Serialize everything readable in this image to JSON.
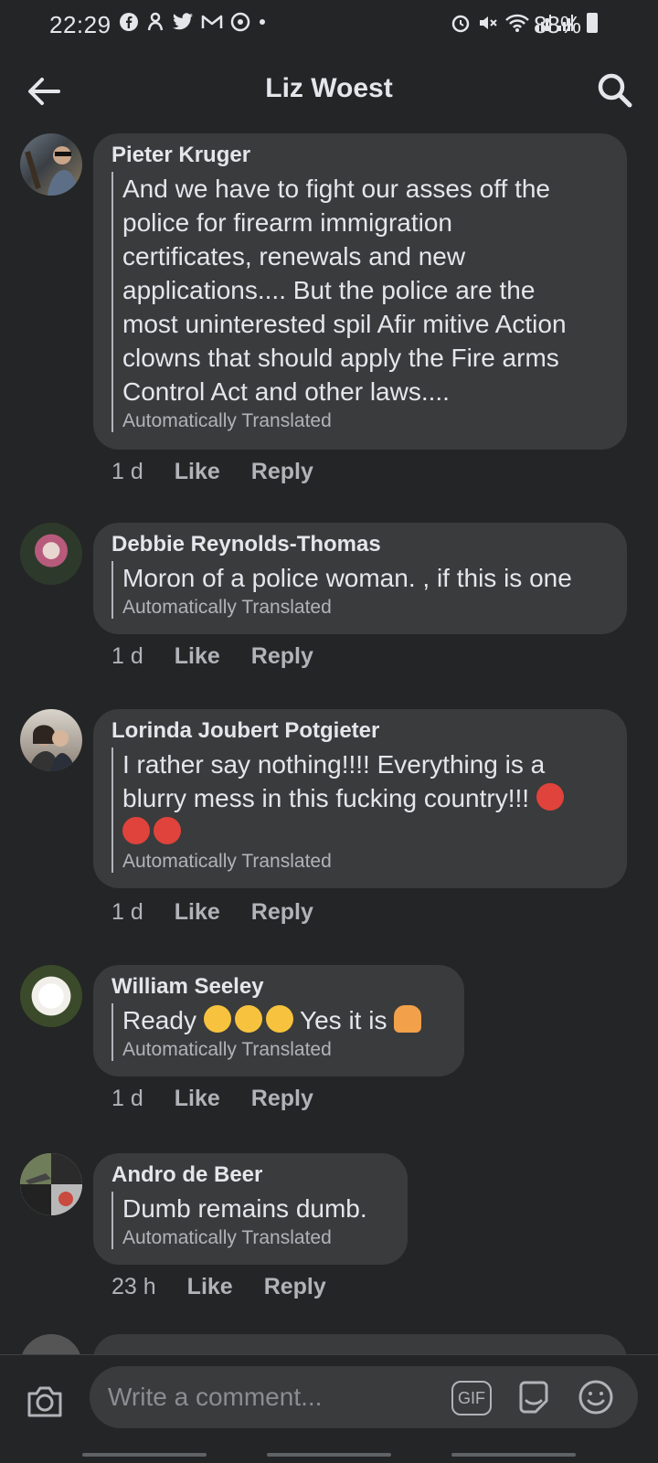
{
  "status_bar": {
    "time": "22:29",
    "battery": "88%"
  },
  "header": {
    "title": "Liz Woest"
  },
  "comments": [
    {
      "author": "Pieter Kruger",
      "lines": [
        "And we have to fight our asses off the",
        "police for firearm immigration",
        "certificates, renewals and new",
        "applications.... But the police are the",
        "most uninterested spil Afir mitive Action",
        "clowns that should apply the Fire arms",
        "Control Act and other laws...."
      ],
      "translation_note": "Automatically Translated",
      "time": "1 d",
      "like": "Like",
      "reply": "Reply"
    },
    {
      "author": "Debbie Reynolds-Thomas",
      "lines": [
        "Moron of a police woman. , if this is one"
      ],
      "translation_note": "Automatically Translated",
      "time": "1 d",
      "like": "Like",
      "reply": "Reply"
    },
    {
      "author": "Lorinda Joubert Potgieter",
      "lines": [
        "I rather say nothing!!!! Everything is a",
        "blurry mess in this fucking country!!!"
      ],
      "translation_note": "Automatically Translated",
      "time": "1 d",
      "like": "Like",
      "reply": "Reply"
    },
    {
      "author": "William Seeley",
      "text_before": "Ready",
      "text_after": " Yes it is",
      "translation_note": "Automatically Translated",
      "time": "1 d",
      "like": "Like",
      "reply": "Reply"
    },
    {
      "author": "Andro de Beer",
      "lines": [
        "Dumb remains dumb."
      ],
      "translation_note": "Automatically Translated",
      "time": "23 h",
      "like": "Like",
      "reply": "Reply"
    }
  ],
  "composer": {
    "placeholder": "Write a comment...",
    "gif_label": "GIF"
  },
  "colors": {
    "background": "#242526",
    "bubble": "#3a3b3c",
    "text_primary": "#e4e6eb",
    "text_secondary": "#b0b3b8"
  }
}
